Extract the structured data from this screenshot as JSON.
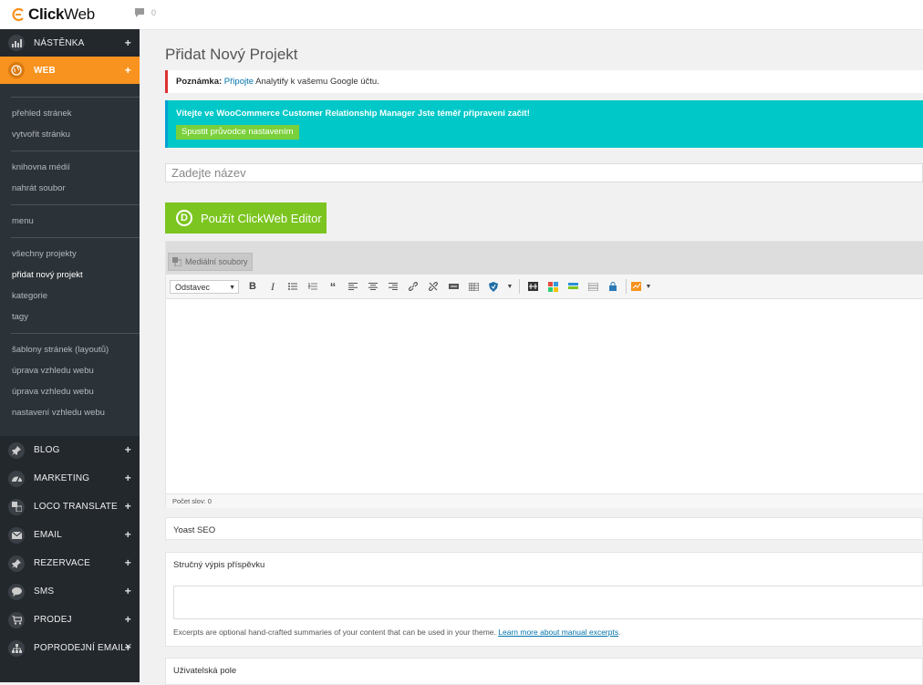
{
  "topbar": {
    "logo_bold": "Click",
    "logo_light": "Web",
    "comments_count": "0"
  },
  "sidebar": {
    "top_items": [
      {
        "label": "NÁSTĚNKA",
        "icon": "chart-icon"
      },
      {
        "label": "WEB",
        "icon": "globe-icon"
      }
    ],
    "web_submenu": [
      [
        "přehled stránek",
        "vytvořit stránku"
      ],
      [
        "knihovna médií",
        "nahrát soubor"
      ],
      [
        "menu"
      ],
      [
        "všechny projekty",
        "přidat nový projekt",
        "kategorie",
        "tagy"
      ],
      [
        "šablony stránek (layoutů)",
        "úprava vzhledu webu",
        "úprava vzhledu webu",
        "nastavení vzhledu webu"
      ]
    ],
    "bottom_items": [
      {
        "label": "BLOG",
        "icon": "pin-icon"
      },
      {
        "label": "MARKETING",
        "icon": "gauge-icon"
      },
      {
        "label": "LOCO TRANSLATE",
        "icon": "translate-icon"
      },
      {
        "label": "EMAIL",
        "icon": "envelope-icon"
      },
      {
        "label": "REZERVACE",
        "icon": "pin-icon"
      },
      {
        "label": "SMS",
        "icon": "chat-icon"
      },
      {
        "label": "PRODEJ",
        "icon": "cart-icon"
      },
      {
        "label": "POPRODEJNÍ EMAILY",
        "icon": "sitemap-icon"
      }
    ],
    "plus": "+"
  },
  "main": {
    "page_title": "Přidat Nový Projekt",
    "notice_bold": "Poznámka:",
    "notice_link": "Připojte",
    "notice_rest": "Analytify k vašemu Google účtu.",
    "woo_text": "Vítejte ve WooCommerce Customer Relationship Manager Jste téměř připraveni začít!",
    "woo_button": "Spustit průvodce nastavením",
    "title_placeholder": "Zadejte název",
    "divi_letter": "D",
    "divi_button": "Použít ClickWeb Editor",
    "media_button": "Mediální soubory",
    "format_select": "Odstavec",
    "word_count": "Počet slov: 0",
    "yoast_title": "Yoast SEO",
    "excerpt_title": "Stručný výpis příspěvku",
    "excerpt_help": "Excerpts are optional hand-crafted summaries of your content that can be used in your theme.",
    "excerpt_link": "Learn more about manual excerpts",
    "excerpt_period": ".",
    "custom_fields_title": "Uživatelská pole"
  },
  "colors": {
    "sidebar_bg": "#23282d",
    "active_orange": "#f7931e",
    "woo_cyan": "#00c8c8",
    "green_button": "#7cc520",
    "notice_red": "#dc3232"
  }
}
